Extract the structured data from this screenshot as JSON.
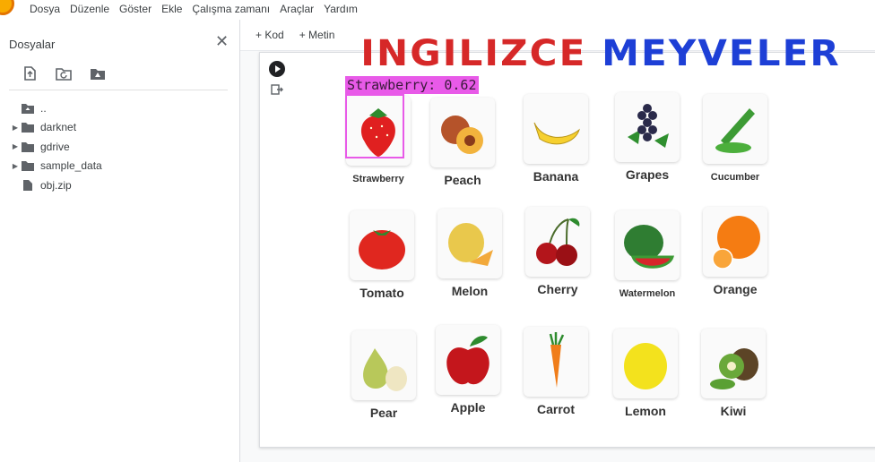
{
  "menu": {
    "items": [
      "Dosya",
      "Düzenle",
      "Göster",
      "Ekle",
      "Çalışma zamanı",
      "Araçlar",
      "Yardım"
    ]
  },
  "sidebar": {
    "title": "Dosyalar",
    "close_icon": "close-icon",
    "tools": [
      "upload-file-icon",
      "refresh-folder-icon",
      "mount-drive-icon"
    ],
    "tree": [
      {
        "label": "..",
        "type": "folder-up",
        "expandable": false
      },
      {
        "label": "darknet",
        "type": "folder",
        "expandable": true
      },
      {
        "label": "gdrive",
        "type": "folder",
        "expandable": true
      },
      {
        "label": "sample_data",
        "type": "folder",
        "expandable": true
      },
      {
        "label": "obj.zip",
        "type": "file",
        "expandable": false
      }
    ]
  },
  "toolbar": {
    "add_code": "+ Kod",
    "add_text": "+ Metin"
  },
  "output": {
    "poster_title_1": "INGILIZCE",
    "poster_title_2": "MEYVELER",
    "detection_label": "Strawberry: 0.62",
    "fruits": [
      {
        "name": "Strawberry",
        "icon": "strawberry"
      },
      {
        "name": "Peach",
        "icon": "peach"
      },
      {
        "name": "Banana",
        "icon": "banana"
      },
      {
        "name": "Grapes",
        "icon": "grapes"
      },
      {
        "name": "Cucumber",
        "icon": "cucumber"
      },
      {
        "name": "Tomato",
        "icon": "tomato"
      },
      {
        "name": "Melon",
        "icon": "melon"
      },
      {
        "name": "Cherry",
        "icon": "cherry"
      },
      {
        "name": "Watermelon",
        "icon": "watermelon"
      },
      {
        "name": "Orange",
        "icon": "orange"
      },
      {
        "name": "Pear",
        "icon": "pear"
      },
      {
        "name": "Apple",
        "icon": "apple"
      },
      {
        "name": "Carrot",
        "icon": "carrot"
      },
      {
        "name": "Lemon",
        "icon": "lemon"
      },
      {
        "name": "Kiwi",
        "icon": "kiwi"
      }
    ]
  }
}
